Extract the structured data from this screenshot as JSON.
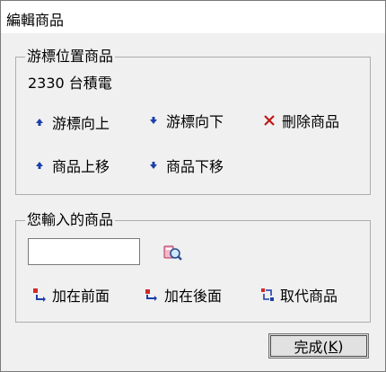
{
  "window": {
    "title": "編輯商品"
  },
  "cursor_group": {
    "label": "游標位置商品",
    "current_item": "2330 台積電",
    "actions": {
      "move_up": "游標向上",
      "move_down": "游標向下",
      "delete": "刪除商品",
      "shift_up": "商品上移",
      "shift_down": "商品下移"
    }
  },
  "input_group": {
    "label": "您輸入的商品",
    "input_value": "",
    "actions": {
      "add_before": "加在前面",
      "add_after": "加在後面",
      "replace": "取代商品"
    }
  },
  "footer": {
    "done_label": "完成(",
    "done_key": "K",
    "done_close": ")"
  },
  "colors": {
    "arrow": "#1c3fa8",
    "delete": "#c01818",
    "accent_red": "#d02a2a"
  }
}
